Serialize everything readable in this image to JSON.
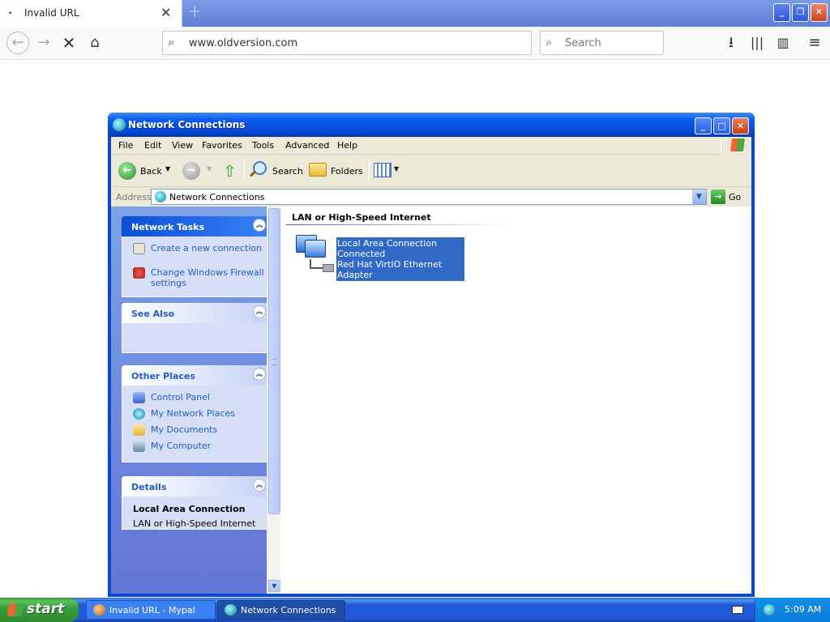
{
  "browser": {
    "tab_title": "Invalid URL",
    "tab_dot": "•",
    "tab_close": "✕",
    "new_tab": "+",
    "url": "www.oldversion.com",
    "search_placeholder": "Search",
    "win_min": "_",
    "win_restore": "❐",
    "win_close": "✕"
  },
  "window": {
    "title": "Network Connections",
    "min": "_",
    "max": "□",
    "close": "✕",
    "menu": [
      "File",
      "Edit",
      "View",
      "Favorites",
      "Tools",
      "Advanced",
      "Help"
    ],
    "toolbar": {
      "back": "Back",
      "search": "Search",
      "folders": "Folders"
    },
    "address": {
      "label": "Address",
      "value": "Network Connections",
      "go": "Go"
    },
    "task_pane": {
      "network_tasks": {
        "title": "Network Tasks",
        "items": [
          "Create a new connection",
          "Change Windows Firewall settings"
        ]
      },
      "see_also": {
        "title": "See Also"
      },
      "other_places": {
        "title": "Other Places",
        "items": [
          "Control Panel",
          "My Network Places",
          "My Documents",
          "My Computer"
        ]
      },
      "details": {
        "title": "Details",
        "name": "Local Area Connection",
        "type": "LAN or High-Speed Internet"
      }
    },
    "content": {
      "group_header": "LAN or High-Speed Internet",
      "connection": {
        "name": "Local Area Connection",
        "status": "Connected",
        "adapter": "Red Hat VirtIO Ethernet Adapter"
      }
    }
  },
  "taskbar": {
    "start": "start",
    "tasks": [
      "Invalid URL - Mypal",
      "Network Connections"
    ],
    "clock": "5:09 AM"
  }
}
